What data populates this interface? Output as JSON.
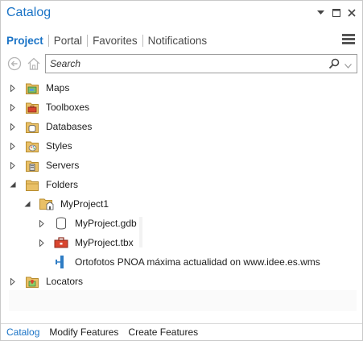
{
  "pane": {
    "title": "Catalog"
  },
  "tabs": [
    {
      "label": "Project"
    },
    {
      "label": "Portal"
    },
    {
      "label": "Favorites"
    },
    {
      "label": "Notifications"
    }
  ],
  "search": {
    "placeholder": "Search"
  },
  "tree": {
    "maps": "Maps",
    "toolboxes": "Toolboxes",
    "databases": "Databases",
    "styles": "Styles",
    "servers": "Servers",
    "folders": "Folders",
    "myproject1": "MyProject1",
    "gdb": "MyProject.gdb",
    "tbx": "MyProject.tbx",
    "wms": "Ortofotos PNOA máxima actualidad on www.idee.es.wms",
    "locators": "Locators"
  },
  "bottom_tabs": [
    {
      "label": "Catalog"
    },
    {
      "label": "Modify Features"
    },
    {
      "label": "Create Features"
    }
  ],
  "icons": {
    "dropdown": "chevron-down-icon",
    "pin": "pin-icon",
    "close": "close-icon",
    "back": "back-arrow-icon",
    "home": "home-icon"
  }
}
